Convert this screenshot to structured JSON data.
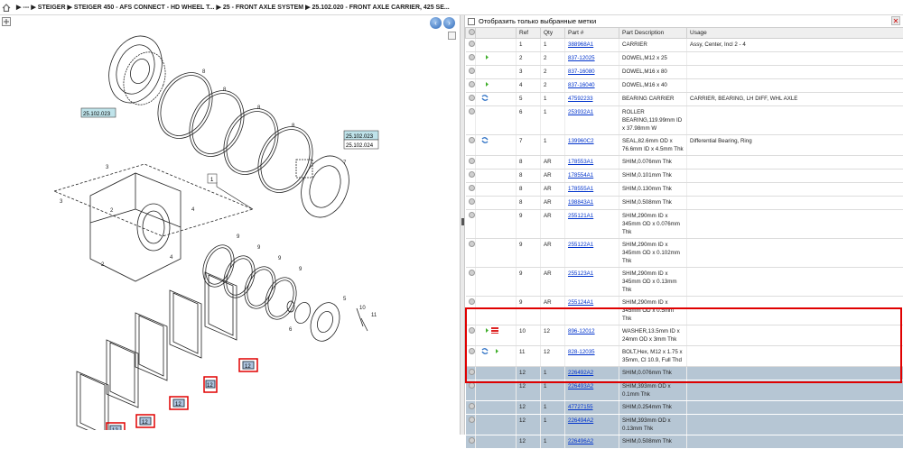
{
  "breadcrumb": {
    "items": [
      "---",
      "STEIGER",
      "STEIGER 450 - AFS CONNECT - HD WHEEL T...",
      "25 - FRONT AXLE SYSTEM",
      "25.102.020 - FRONT AXLE CARRIER, 425 SE..."
    ]
  },
  "diagram": {
    "refs": [
      "25.102.023",
      "25.102.023",
      "25.102.024"
    ],
    "callouts": [
      "1",
      "2",
      "2",
      "3",
      "3",
      "4",
      "4",
      "5",
      "6",
      "7",
      "8",
      "8",
      "8",
      "8",
      "9",
      "9",
      "9",
      "9",
      "10",
      "11"
    ],
    "highlight_labels": [
      "12",
      "12",
      "12",
      "12",
      "12"
    ]
  },
  "filter": {
    "label": "Отобразить только выбранные метки"
  },
  "table": {
    "headers": [
      "",
      "",
      "Ref",
      "Qty",
      "Part #",
      "Part Description",
      "Usage"
    ],
    "rows": [
      {
        "ref": "1",
        "qty": "1",
        "part": "388968A1",
        "desc": "CARRIER",
        "usage": "Assy, Center, Incl 2 - 4",
        "icons": [],
        "sel": false
      },
      {
        "ref": "2",
        "qty": "2",
        "part": "837-12025",
        "desc": "DOWEL,M12 x 25",
        "usage": "",
        "icons": [
          "green"
        ],
        "sel": false
      },
      {
        "ref": "3",
        "qty": "2",
        "part": "837-16080",
        "desc": "DOWEL,M16 x 80",
        "usage": "",
        "icons": [],
        "sel": false
      },
      {
        "ref": "4",
        "qty": "2",
        "part": "837-16040",
        "desc": "DOWEL,M16 x 40",
        "usage": "",
        "icons": [
          "green"
        ],
        "sel": false
      },
      {
        "ref": "5",
        "qty": "1",
        "part": "47592233",
        "desc": "BEARING CARRIER",
        "usage": "CARRIER, BEARING, LH DIFF, WHL AXLE",
        "icons": [
          "blue"
        ],
        "sel": false
      },
      {
        "ref": "6",
        "qty": "1",
        "part": "253932A1",
        "desc": "ROLLER BEARING,119.99mm ID x 37.98mm W",
        "usage": "",
        "icons": [],
        "sel": false
      },
      {
        "ref": "7",
        "qty": "1",
        "part": "139960C2",
        "desc": "SEAL,82.6mm OD x 76.6mm ID x 4.5mm Thk",
        "usage": "Differential Bearing, Ring",
        "icons": [
          "blue"
        ],
        "sel": false
      },
      {
        "ref": "8",
        "qty": "AR",
        "part": "178553A1",
        "desc": "SHIM,0.076mm Thk",
        "usage": "",
        "icons": [],
        "sel": false
      },
      {
        "ref": "8",
        "qty": "AR",
        "part": "178554A1",
        "desc": "SHIM,0.101mm Thk",
        "usage": "",
        "icons": [],
        "sel": false
      },
      {
        "ref": "8",
        "qty": "AR",
        "part": "178555A1",
        "desc": "SHIM,0.130mm Thk",
        "usage": "",
        "icons": [],
        "sel": false
      },
      {
        "ref": "8",
        "qty": "AR",
        "part": "198843A1",
        "desc": "SHIM,0.508mm Thk",
        "usage": "",
        "icons": [],
        "sel": false
      },
      {
        "ref": "9",
        "qty": "AR",
        "part": "255121A1",
        "desc": "SHIM,290mm ID x 345mm OD x 0.076mm Thk",
        "usage": "",
        "icons": [],
        "sel": false
      },
      {
        "ref": "9",
        "qty": "AR",
        "part": "255122A1",
        "desc": "SHIM,290mm ID x 345mm OD x 0.102mm Thk",
        "usage": "",
        "icons": [],
        "sel": false
      },
      {
        "ref": "9",
        "qty": "AR",
        "part": "255123A1",
        "desc": "SHIM,290mm ID x 345mm OD x 0.13mm Thk",
        "usage": "",
        "icons": [],
        "sel": false
      },
      {
        "ref": "9",
        "qty": "AR",
        "part": "255124A1",
        "desc": "SHIM,290mm ID x 345mm OD x 0.5mm Thk",
        "usage": "",
        "icons": [],
        "sel": false
      },
      {
        "ref": "10",
        "qty": "12",
        "part": "896-12012",
        "desc": "WASHER,13.5mm ID x 24mm OD x 3mm Thk",
        "usage": "",
        "icons": [
          "green",
          "red"
        ],
        "sel": false
      },
      {
        "ref": "11",
        "qty": "12",
        "part": "828-12035",
        "desc": "BOLT,Hex, M12 x 1.75 x 35mm, Cl 10.9, Full Thd",
        "usage": "",
        "icons": [
          "blue",
          "green"
        ],
        "sel": false
      },
      {
        "ref": "12",
        "qty": "1",
        "part": "226492A2",
        "desc": "SHIM,0.076mm Thk",
        "usage": "",
        "icons": [],
        "sel": true
      },
      {
        "ref": "12",
        "qty": "1",
        "part": "226493A2",
        "desc": "SHIM,393mm OD x 0.1mm Thk",
        "usage": "",
        "icons": [],
        "sel": true
      },
      {
        "ref": "12",
        "qty": "1",
        "part": "47727155",
        "desc": "SHIM,0.254mm Thk",
        "usage": "",
        "icons": [],
        "sel": true
      },
      {
        "ref": "12",
        "qty": "1",
        "part": "226494A2",
        "desc": "SHIM,393mm OD x 0.13mm Thk",
        "usage": "",
        "icons": [],
        "sel": true
      },
      {
        "ref": "12",
        "qty": "1",
        "part": "226496A2",
        "desc": "SHIM,0.508mm Thk",
        "usage": "",
        "icons": [],
        "sel": true
      }
    ]
  },
  "colors": {
    "selected_row": "#b6c6d4",
    "highlight_border": "#e00000",
    "link": "#0033cc"
  }
}
